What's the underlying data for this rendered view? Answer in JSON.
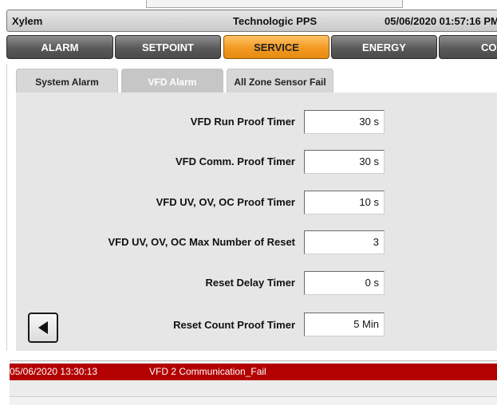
{
  "header": {
    "company": "Xylem",
    "system": "Technologic PPS",
    "datetime": "05/06/2020 01:57:16 PM"
  },
  "nav": {
    "tabs": [
      {
        "label": "ALARM",
        "active": false
      },
      {
        "label": "SETPOINT",
        "active": false
      },
      {
        "label": "SERVICE",
        "active": true
      },
      {
        "label": "ENERGY",
        "active": false
      },
      {
        "label": "CON",
        "active": false
      }
    ]
  },
  "subtabs": [
    {
      "label": "System Alarm",
      "active": false
    },
    {
      "label": "VFD Alarm",
      "active": true
    },
    {
      "label": "All Zone Sensor Fail",
      "active": false
    }
  ],
  "settings": [
    {
      "label": "VFD Run Proof Timer",
      "value": "30 s"
    },
    {
      "label": "VFD Comm. Proof Timer",
      "value": "30 s"
    },
    {
      "label": "VFD UV, OV, OC Proof Timer",
      "value": "10 s"
    },
    {
      "label": "VFD UV, OV, OC Max Number of Reset",
      "value": "3"
    },
    {
      "label": "Reset Delay Timer",
      "value": "0 s"
    },
    {
      "label": "Reset Count Proof Timer",
      "value": "5 Min"
    }
  ],
  "back_button": {
    "icon": "triangle-left-icon"
  },
  "alarm": {
    "timestamp": "05/06/2020 13:30:13",
    "message": "VFD 2 Communication_Fail",
    "color": "#b30000"
  },
  "colors": {
    "active_tab": "#f29a22",
    "inactive_tab": "#5a5a5a",
    "alarm": "#b30000"
  }
}
